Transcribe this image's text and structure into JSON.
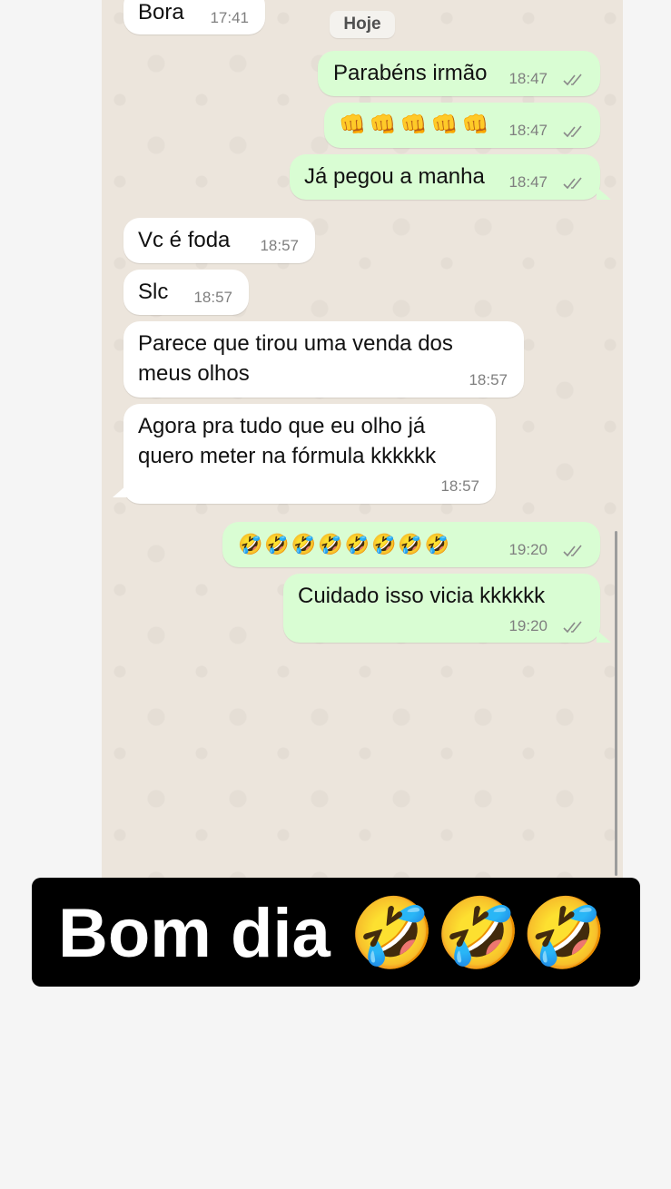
{
  "date_separator": "Hoje",
  "messages": [
    {
      "id": "m0",
      "dir": "in",
      "text": "Bora",
      "time": "17:41"
    },
    {
      "id": "m1",
      "dir": "out",
      "text": "Parabéns irmão",
      "time": "18:47"
    },
    {
      "id": "m2",
      "dir": "out",
      "text": "👊👊👊👊👊",
      "time": "18:47"
    },
    {
      "id": "m3",
      "dir": "out",
      "text": "Já pegou a manha",
      "time": "18:47"
    },
    {
      "id": "m4",
      "dir": "in",
      "text": "Vc é foda",
      "time": "18:57"
    },
    {
      "id": "m5",
      "dir": "in",
      "text": "Slc",
      "time": "18:57"
    },
    {
      "id": "m6",
      "dir": "in",
      "lines": [
        "Parece que tirou uma venda dos",
        "meus olhos"
      ],
      "time": "18:57"
    },
    {
      "id": "m7",
      "dir": "in",
      "lines": [
        "Agora pra tudo que eu olho já",
        "quero meter na fórmula kkkkkk"
      ],
      "time": "18:57"
    },
    {
      "id": "m8",
      "dir": "out",
      "text": "🤣🤣🤣🤣🤣🤣🤣🤣",
      "time": "19:20"
    },
    {
      "id": "m9",
      "dir": "out",
      "text": "Cuidado isso vicia kkkkkk",
      "time": "19:20"
    }
  ],
  "caption": {
    "text": "Bom dia 🤣🤣🤣"
  },
  "icons": {
    "read_receipt": "double-check-icon"
  },
  "colors": {
    "incoming": "#ffffff",
    "outgoing": "#d9fdd3",
    "chat_bg": "#ece5dc",
    "tick": "#8a8a8a",
    "caption_bg": "#000000"
  }
}
